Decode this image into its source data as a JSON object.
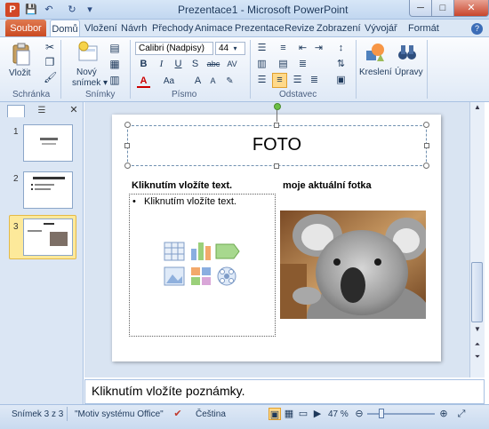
{
  "window": {
    "title": "Prezentace1 - Microsoft PowerPoint",
    "min": "─",
    "max": "□",
    "close": "✕"
  },
  "tabs": [
    {
      "label": "Soubor"
    },
    {
      "label": "Domů"
    },
    {
      "label": "Vložení"
    },
    {
      "label": "Návrh"
    },
    {
      "label": "Přechody"
    },
    {
      "label": "Animace"
    },
    {
      "label": "Prezentace"
    },
    {
      "label": "Revize"
    },
    {
      "label": "Zobrazení"
    },
    {
      "label": "Vývojář"
    },
    {
      "label": "Formát"
    }
  ],
  "help": "?",
  "ribbon": {
    "clipboard": {
      "label": "Schránka",
      "paste": "Vložit"
    },
    "slides": {
      "label": "Snímky",
      "new_slide_line1": "Nový",
      "new_slide_line2": "snímek ▾"
    },
    "font": {
      "label": "Písmo",
      "font_name": "Calibri (Nadpisy)",
      "font_size": "44"
    },
    "paragraph": {
      "label": "Odstavec"
    },
    "drawing": {
      "label": "Kreslení"
    },
    "editing": {
      "label": "Úpravy"
    }
  },
  "thumbnails": [
    {
      "num": "1"
    },
    {
      "num": "2"
    },
    {
      "num": "3"
    }
  ],
  "slide": {
    "title": "FOTO",
    "left_heading": "Kliknutím vložíte text.",
    "left_bullet": "Kliknutím vložíte text.",
    "right_heading": "moje aktuální fotka"
  },
  "notes": {
    "placeholder": "Kliknutím vložíte poznámky."
  },
  "status": {
    "slide_counter": "Snímek 3 z 3",
    "theme": "\"Motiv systému Office\"",
    "language": "Čeština",
    "zoom": "47 %"
  },
  "colors": {
    "accent_file_tab": "#c9471f",
    "ribbon_bg": "#dfe9f6",
    "selected_thumb": "#fde99a"
  }
}
